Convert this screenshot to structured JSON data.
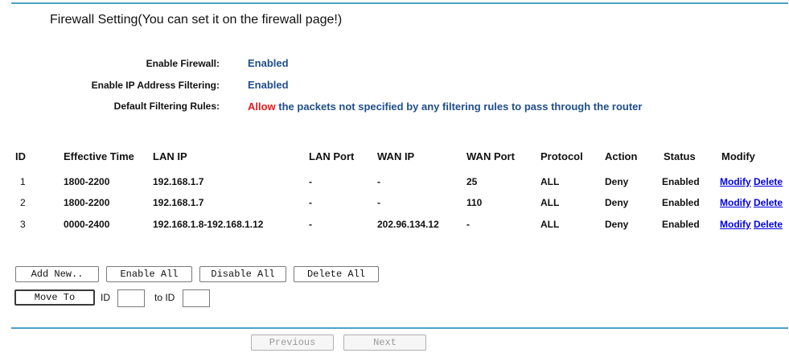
{
  "title": "Firewall Setting(You can set it on the firewall page!)",
  "summary": {
    "firewall_label": "Enable Firewall:",
    "firewall_value": "Enabled",
    "ipfilter_label": "Enable IP Address Filtering:",
    "ipfilter_value": "Enabled",
    "default_label": "Default Filtering Rules:",
    "default_allow": "Allow",
    "default_rest": " the packets not specified by any filtering rules to pass through the router"
  },
  "table": {
    "headers": {
      "id": "ID",
      "time": "Effective Time",
      "lan_ip": "LAN IP",
      "lan_port": "LAN Port",
      "wan_ip": "WAN IP",
      "wan_port": "WAN Port",
      "protocol": "Protocol",
      "action": "Action",
      "status": "Status",
      "modify": "Modify"
    },
    "rows": [
      {
        "id": "1",
        "time": "1800-2200",
        "lan_ip": "192.168.1.7",
        "lan_port": "-",
        "wan_ip": "-",
        "wan_port": "25",
        "protocol": "ALL",
        "action": "Deny",
        "status": "Enabled",
        "modify": "Modify",
        "delete": "Delete"
      },
      {
        "id": "2",
        "time": "1800-2200",
        "lan_ip": "192.168.1.7",
        "lan_port": "-",
        "wan_ip": "-",
        "wan_port": "110",
        "protocol": "ALL",
        "action": "Deny",
        "status": "Enabled",
        "modify": "Modify",
        "delete": "Delete"
      },
      {
        "id": "3",
        "time": "0000-2400",
        "lan_ip": "192.168.1.8-192.168.1.12",
        "lan_port": "-",
        "wan_ip": "202.96.134.12",
        "wan_port": "-",
        "protocol": "ALL",
        "action": "Deny",
        "status": "Enabled",
        "modify": "Modify",
        "delete": "Delete"
      }
    ]
  },
  "buttons": {
    "add_new": "Add New..",
    "enable_all": "Enable All",
    "disable_all": "Disable All",
    "delete_all": "Delete All",
    "move_to": "Move To",
    "previous": "Previous",
    "next": "Next"
  },
  "move": {
    "id_label": "ID",
    "id_value": "",
    "to_label": "to ID",
    "to_value": ""
  }
}
